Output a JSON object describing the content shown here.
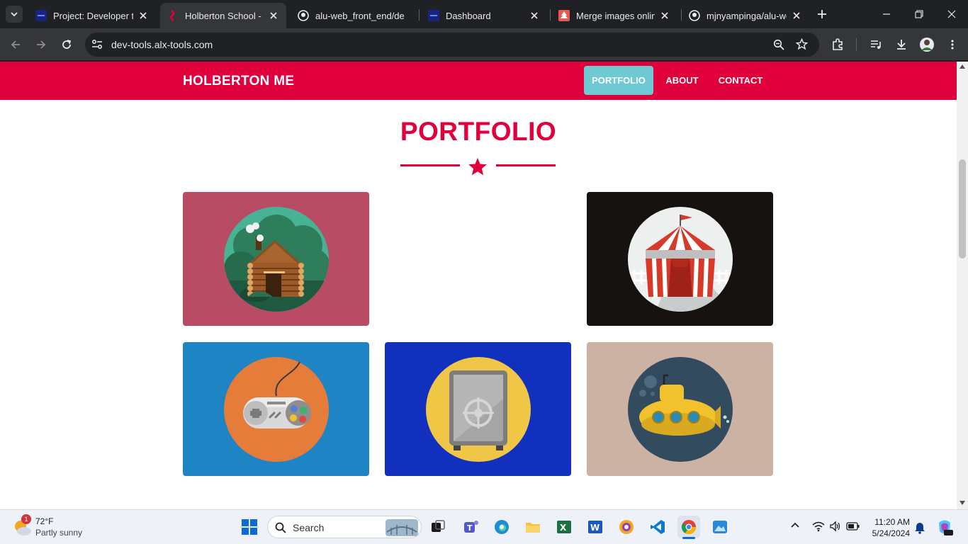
{
  "browser": {
    "tabs": [
      {
        "title": "Project: Developer too",
        "active": false
      },
      {
        "title": "Holberton School - Da",
        "active": true
      },
      {
        "title": "alu-web_front_end/de",
        "active": false
      },
      {
        "title": "Dashboard",
        "active": false
      },
      {
        "title": "Merge images online",
        "active": false
      },
      {
        "title": "mjnyampinga/alu-we",
        "active": false
      }
    ],
    "url": "dev-tools.alx-tools.com"
  },
  "page": {
    "brand": "HOLBERTON ME",
    "nav": [
      {
        "label": "PORTFOLIO",
        "active": true
      },
      {
        "label": "ABOUT",
        "active": false
      },
      {
        "label": "CONTACT",
        "active": false
      }
    ],
    "section_title": "PORTFOLIO",
    "accent_color": "#e0003c",
    "active_nav_color": "#6ec9d3",
    "portfolio": [
      {
        "icon": "cabin-icon",
        "bg": "#b84c65"
      },
      {
        "icon": "circus-tent-icon",
        "bg": "#161210"
      },
      {
        "icon": "game-controller-icon",
        "bg": "#1e84c3"
      },
      {
        "icon": "safe-icon",
        "bg": "#1130bd"
      },
      {
        "icon": "submarine-icon",
        "bg": "#cbb2a3"
      }
    ]
  },
  "taskbar": {
    "weather_temp": "72°F",
    "weather_desc": "Partly sunny",
    "weather_badge": "1",
    "search_label": "Search",
    "time": "11:20 AM",
    "date": "5/24/2024"
  }
}
